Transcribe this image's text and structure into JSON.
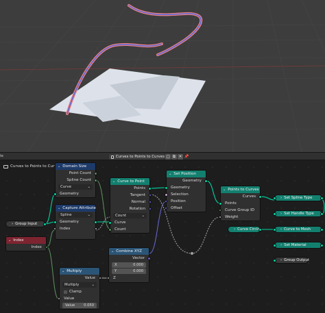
{
  "editor_header": {
    "edge_label": "le",
    "tree_name": "Curves to Points to Curves",
    "buttons": [
      "▢",
      "⧉",
      "✕",
      "📌"
    ]
  },
  "breadcrumb": "Curves to Points to Curves",
  "nodes": {
    "domain_size": {
      "title": "Domain Size",
      "outputs": [
        "Point Count",
        "Spline Count"
      ],
      "dropdown": "Curve",
      "input": "Geometry"
    },
    "capture_attribute": {
      "title": "Capture Attribute",
      "dropdown": "Spline",
      "rows": [
        "Geometry",
        "Index"
      ]
    },
    "curve_to_point": {
      "title": "Curve to Point",
      "outputs": [
        "Points",
        "Tangent",
        "Normal",
        "Rotation"
      ],
      "dropdown": "Count",
      "inputs": [
        "Curve",
        "Count"
      ]
    },
    "set_position": {
      "title": "Set Position",
      "output": "Geometry",
      "inputs": [
        "Geometry",
        "Selection",
        "Position",
        "Offset"
      ]
    },
    "points_to_curves": {
      "title": "Points to Curves",
      "output": "Curves",
      "inputs": [
        "Points",
        "Curve Group ID",
        "Weight"
      ]
    },
    "index": {
      "title": "Index",
      "output": "Index"
    },
    "combine_xyz": {
      "title": "Combine XYZ",
      "output": "Vector",
      "fields": [
        {
          "label": "X",
          "value": "0.000"
        },
        {
          "label": "Y",
          "value": "0.000"
        }
      ],
      "input": "Z"
    },
    "multiply": {
      "title": "Multiply",
      "output": "Value",
      "dropdown": "Multiply",
      "checkbox": "Clamp",
      "input": "Value",
      "field": {
        "label": "Value",
        "value": "0.050"
      }
    },
    "group_input": {
      "title": "Group Input"
    },
    "group_output": {
      "title": "Group Output"
    },
    "set_spline_type": {
      "title": "Set Spline Type"
    },
    "set_handle_type": {
      "title": "Set Handle Type"
    },
    "curve_circle": {
      "title": "Curve Circle"
    },
    "curve_to_mesh": {
      "title": "Curve to Mesh"
    },
    "set_material": {
      "title": "Set Material"
    }
  }
}
